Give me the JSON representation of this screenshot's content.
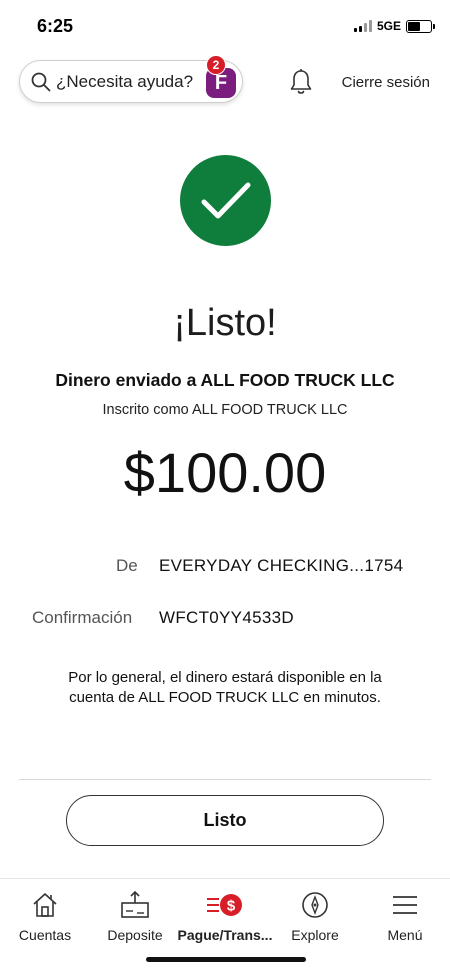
{
  "status_bar": {
    "time": "6:25",
    "network": "5GE",
    "battery_level": 0.55
  },
  "header": {
    "search_text": "¿Necesita ayuda?",
    "assistant_letter": "F",
    "assistant_badge_count": "2",
    "signout_label": "Cierre sesión"
  },
  "confirmation": {
    "title": "¡Listo!",
    "recipient_line": "Dinero enviado a ALL FOOD TRUCK LLC",
    "enrolled_line": "Inscrito como ALL FOOD TRUCK LLC",
    "amount": "$100.00",
    "from_label": "De",
    "from_value": "EVERYDAY CHECKING...1754",
    "confirmation_label": "Confirmación",
    "confirmation_value": "WFCT0YY4533D",
    "availability_note": "Por lo general, el dinero estará disponible en la cuenta de ALL FOOD TRUCK LLC en minutos.",
    "done_button": "Listo"
  },
  "tab_bar": {
    "tabs": [
      {
        "label": "Cuentas",
        "icon": "home-icon"
      },
      {
        "label": "Deposite",
        "icon": "deposit-icon"
      },
      {
        "label": "Pague/Trans...",
        "icon": "pay-transfer-icon"
      },
      {
        "label": "Explore",
        "icon": "compass-icon"
      },
      {
        "label": "Menú",
        "icon": "menu-icon"
      }
    ],
    "active_index": 2
  },
  "colors": {
    "success_green": "#0f7d3b",
    "brand_red": "#d71e28",
    "assistant_purple": "#7b1d7e"
  }
}
